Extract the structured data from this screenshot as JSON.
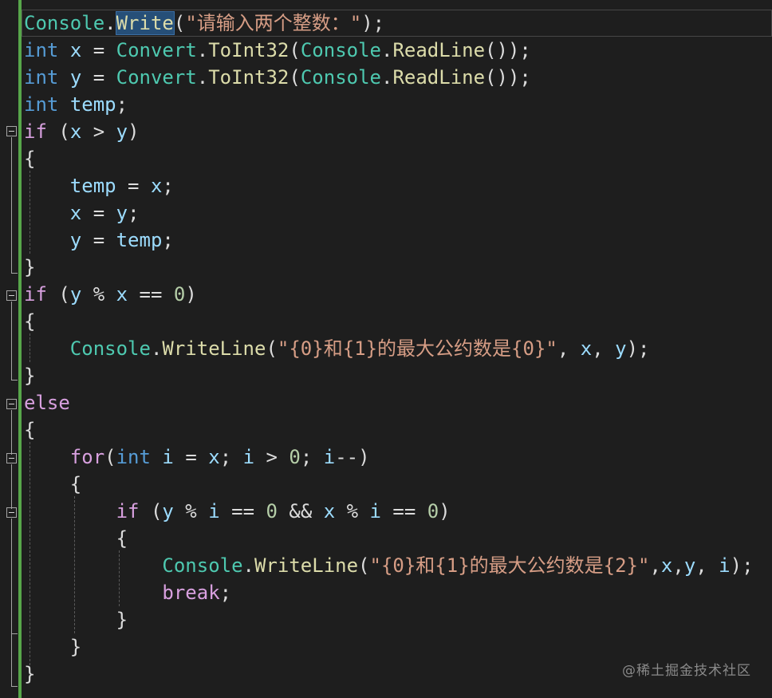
{
  "colors": {
    "bg": "#1e1e1e",
    "bar": "#57a64a",
    "class": "#4ec9b0",
    "method": "#dcdcaa",
    "keyword": "#569cd6",
    "control": "#d8a0df",
    "variable": "#9cdcfe",
    "string": "#d69d85",
    "number": "#b5cea8",
    "plain": "#dcdcdc",
    "highlight_bg": "#264f78",
    "highlight_border": "#3a6ea5"
  },
  "watermark": "@稀土掘金技术社区",
  "lines": [
    [
      [
        "cls",
        "Console"
      ],
      [
        "p",
        "."
      ],
      [
        "m",
        "Write",
        true
      ],
      [
        "p",
        "("
      ],
      [
        "s",
        "\"请输入两个整数：\""
      ],
      [
        "p",
        ");"
      ]
    ],
    [
      [
        "kw",
        "int"
      ],
      [
        "p",
        " "
      ],
      [
        "v",
        "x"
      ],
      [
        "p",
        " = "
      ],
      [
        "cls",
        "Convert"
      ],
      [
        "p",
        "."
      ],
      [
        "m",
        "ToInt32"
      ],
      [
        "p",
        "("
      ],
      [
        "cls",
        "Console"
      ],
      [
        "p",
        "."
      ],
      [
        "m",
        "ReadLine"
      ],
      [
        "p",
        "());"
      ]
    ],
    [
      [
        "kw",
        "int"
      ],
      [
        "p",
        " "
      ],
      [
        "v",
        "y"
      ],
      [
        "p",
        " = "
      ],
      [
        "cls",
        "Convert"
      ],
      [
        "p",
        "."
      ],
      [
        "m",
        "ToInt32"
      ],
      [
        "p",
        "("
      ],
      [
        "cls",
        "Console"
      ],
      [
        "p",
        "."
      ],
      [
        "m",
        "ReadLine"
      ],
      [
        "p",
        "());"
      ]
    ],
    [
      [
        "kw",
        "int"
      ],
      [
        "p",
        " "
      ],
      [
        "v",
        "temp"
      ],
      [
        "p",
        ";"
      ]
    ],
    [
      [
        "ctrl",
        "if"
      ],
      [
        "p",
        " ("
      ],
      [
        "v",
        "x"
      ],
      [
        "p",
        " > "
      ],
      [
        "v",
        "y"
      ],
      [
        "p",
        ")"
      ]
    ],
    [
      [
        "p",
        "{"
      ]
    ],
    [
      [
        "p",
        "    "
      ],
      [
        "v",
        "temp"
      ],
      [
        "p",
        " = "
      ],
      [
        "v",
        "x"
      ],
      [
        "p",
        ";"
      ]
    ],
    [
      [
        "p",
        "    "
      ],
      [
        "v",
        "x"
      ],
      [
        "p",
        " = "
      ],
      [
        "v",
        "y"
      ],
      [
        "p",
        ";"
      ]
    ],
    [
      [
        "p",
        "    "
      ],
      [
        "v",
        "y"
      ],
      [
        "p",
        " = "
      ],
      [
        "v",
        "temp"
      ],
      [
        "p",
        ";"
      ]
    ],
    [
      [
        "p",
        "}"
      ]
    ],
    [
      [
        "ctrl",
        "if"
      ],
      [
        "p",
        " ("
      ],
      [
        "v",
        "y"
      ],
      [
        "p",
        " % "
      ],
      [
        "v",
        "x"
      ],
      [
        "p",
        " == "
      ],
      [
        "n",
        "0"
      ],
      [
        "p",
        ")"
      ]
    ],
    [
      [
        "p",
        "{"
      ]
    ],
    [
      [
        "p",
        "    "
      ],
      [
        "cls",
        "Console"
      ],
      [
        "p",
        "."
      ],
      [
        "m",
        "WriteLine"
      ],
      [
        "p",
        "("
      ],
      [
        "s",
        "\"{0}和{1}的最大公约数是{0}\""
      ],
      [
        "p",
        ", "
      ],
      [
        "v",
        "x"
      ],
      [
        "p",
        ", "
      ],
      [
        "v",
        "y"
      ],
      [
        "p",
        ");"
      ]
    ],
    [
      [
        "p",
        "}"
      ]
    ],
    [
      [
        "ctrl",
        "else"
      ]
    ],
    [
      [
        "p",
        "{"
      ]
    ],
    [
      [
        "p",
        "    "
      ],
      [
        "ctrl",
        "for"
      ],
      [
        "p",
        "("
      ],
      [
        "kw",
        "int"
      ],
      [
        "p",
        " "
      ],
      [
        "v",
        "i"
      ],
      [
        "p",
        " = "
      ],
      [
        "v",
        "x"
      ],
      [
        "p",
        "; "
      ],
      [
        "v",
        "i"
      ],
      [
        "p",
        " > "
      ],
      [
        "n",
        "0"
      ],
      [
        "p",
        "; "
      ],
      [
        "v",
        "i"
      ],
      [
        "p",
        "--)"
      ]
    ],
    [
      [
        "p",
        "    {"
      ]
    ],
    [
      [
        "p",
        "        "
      ],
      [
        "ctrl",
        "if"
      ],
      [
        "p",
        " ("
      ],
      [
        "v",
        "y"
      ],
      [
        "p",
        " % "
      ],
      [
        "v",
        "i"
      ],
      [
        "p",
        " == "
      ],
      [
        "n",
        "0"
      ],
      [
        "p",
        " && "
      ],
      [
        "v",
        "x"
      ],
      [
        "p",
        " % "
      ],
      [
        "v",
        "i"
      ],
      [
        "p",
        " == "
      ],
      [
        "n",
        "0"
      ],
      [
        "p",
        ")"
      ]
    ],
    [
      [
        "p",
        "        {"
      ]
    ],
    [
      [
        "p",
        "            "
      ],
      [
        "cls",
        "Console"
      ],
      [
        "p",
        "."
      ],
      [
        "m",
        "WriteLine"
      ],
      [
        "p",
        "("
      ],
      [
        "s",
        "\"{0}和{1}的最大公约数是{2}\""
      ],
      [
        "p",
        ","
      ],
      [
        "v",
        "x"
      ],
      [
        "p",
        ","
      ],
      [
        "v",
        "y"
      ],
      [
        "p",
        ", "
      ],
      [
        "v",
        "i"
      ],
      [
        "p",
        ");"
      ]
    ],
    [
      [
        "p",
        "            "
      ],
      [
        "ctrl",
        "break"
      ],
      [
        "p",
        ";"
      ]
    ],
    [
      [
        "p",
        "        }"
      ]
    ],
    [
      [
        "p",
        "    }"
      ]
    ],
    [
      [
        "p",
        "}"
      ]
    ]
  ]
}
